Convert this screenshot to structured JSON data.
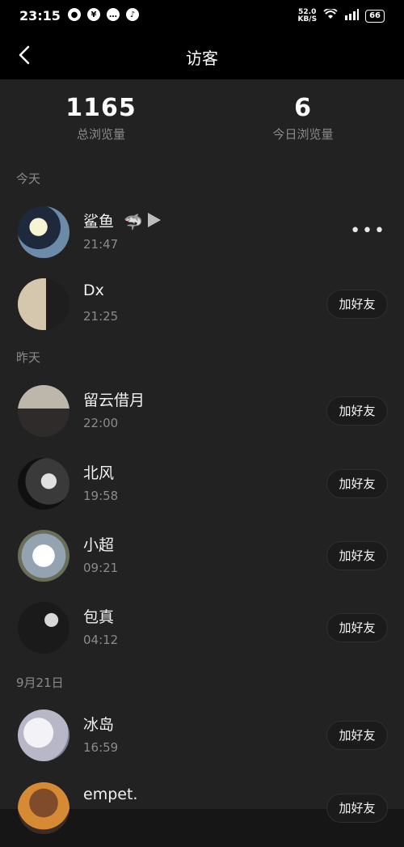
{
  "status": {
    "time": "23:15",
    "speed": "52.0\nKB/S",
    "battery": "66"
  },
  "header": {
    "title": "访客"
  },
  "stats": {
    "total_views": "1165",
    "total_views_label": "总浏览量",
    "today_views": "6",
    "today_views_label": "今日浏览量"
  },
  "sections": {
    "today": "今天",
    "yesterday": "昨天",
    "sep21": "9月21日"
  },
  "visitors": [
    {
      "name": "鲨鱼",
      "time": "21:47",
      "action": "more"
    },
    {
      "name": "Dx",
      "time": "21:25",
      "action": "加好友"
    },
    {
      "name": "留云借月",
      "time": "22:00",
      "action": "加好友"
    },
    {
      "name": "北风",
      "time": "19:58",
      "action": "加好友"
    },
    {
      "name": "小超",
      "time": "09:21",
      "action": "加好友"
    },
    {
      "name": "包真",
      "time": "04:12",
      "action": "加好友"
    },
    {
      "name": "冰岛",
      "time": "16:59",
      "action": "加好友"
    },
    {
      "name": "empet.",
      "time": "",
      "action": "加好友"
    }
  ],
  "more_label": "•••"
}
